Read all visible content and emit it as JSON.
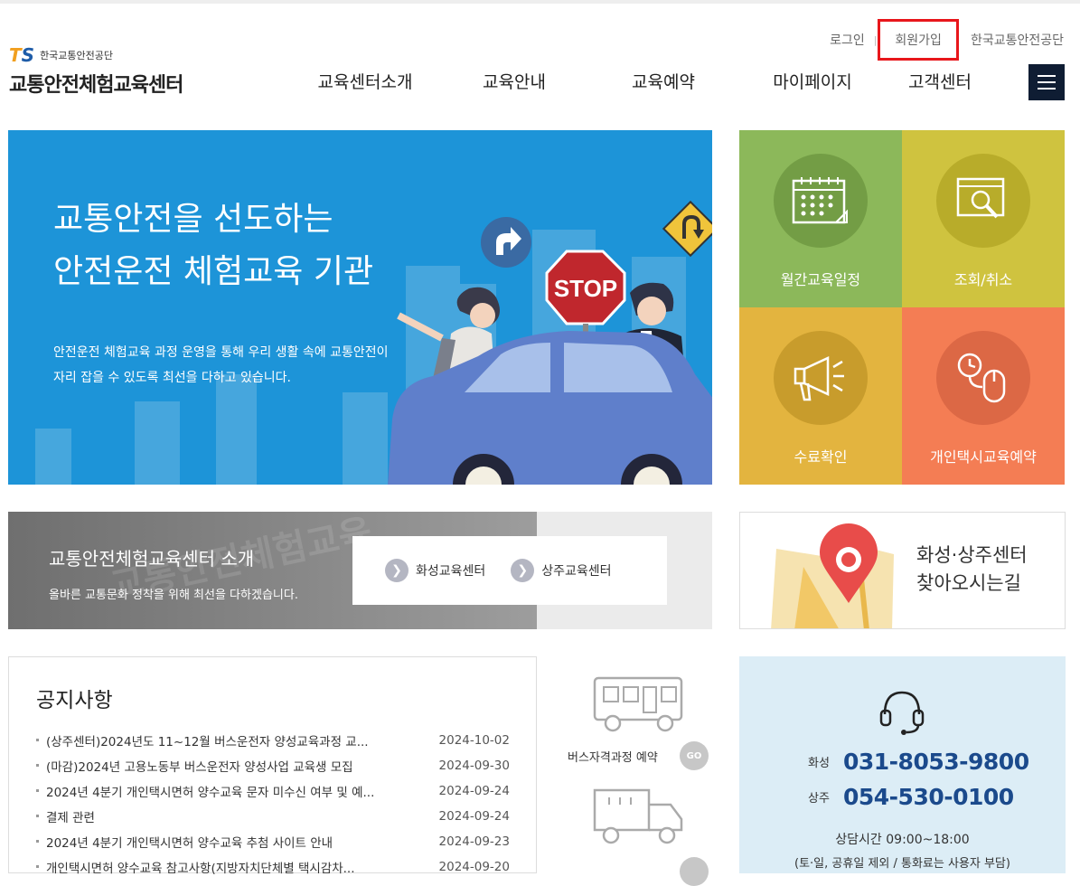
{
  "header": {
    "login": "로그인",
    "separator": "|",
    "join": "회원가입",
    "org_link": "한국교통안전공단",
    "logo_mark_t": "T",
    "logo_mark_s": "S",
    "logo_org": "한국교통안전공단",
    "logo_name": "교통안전체험교육센터"
  },
  "nav": {
    "items": [
      "교육센터소개",
      "교육안내",
      "교육예약",
      "마이페이지",
      "고객센터"
    ]
  },
  "hero": {
    "title_line1": "교통안전을 선도하는",
    "title_line2": "안전운전 체험교육 기관",
    "desc_line1": "안전운전 체험교육 과정 운영을 통해 우리 생활 속에 교통안전이",
    "desc_line2": "자리 잡을 수 있도록 최선을 다하고 있습니다.",
    "stop_sign": "STOP"
  },
  "quick": {
    "items": [
      {
        "label": "월간교육일정",
        "color": "#8cb85a",
        "circle": "#739d45",
        "icon": "calendar-icon"
      },
      {
        "label": "조회/취소",
        "color": "#cfc33f",
        "circle": "#b8ac2a",
        "icon": "search-window-icon"
      },
      {
        "label": "수료확인",
        "color": "#e3b43f",
        "circle": "#c89c2c",
        "icon": "megaphone-icon"
      },
      {
        "label": "개인택시교육예약",
        "color": "#f47d54",
        "circle": "#dc6845",
        "icon": "mouse-clock-icon"
      }
    ]
  },
  "intro": {
    "bg_text": "교통안전체험교육",
    "title": "교통안전체험교육센터 소개",
    "subtitle": "올바른 교통문화 정착을 위해 최선을 다하겠습니다.",
    "link1": "화성교육센터",
    "link2": "상주교육센터"
  },
  "directions": {
    "line1": "화성·상주센터",
    "line2": "찾아오시는길"
  },
  "notice": {
    "title": "공지사항",
    "rows": [
      {
        "title": "(상주센터)2024년도 11~12월 버스운전자 양성교육과정 교...",
        "date": "2024-10-02"
      },
      {
        "title": "(마감)2024년 고용노동부 버스운전자 양성사업 교육생 모집",
        "date": "2024-09-30"
      },
      {
        "title": "2024년 4분기 개인택시면허 양수교육 문자 미수신 여부 및 예...",
        "date": "2024-09-24"
      },
      {
        "title": "결제 관련",
        "date": "2024-09-24"
      },
      {
        "title": "2024년 4분기 개인택시면허 양수교육 추첨 사이트 안내",
        "date": "2024-09-23"
      },
      {
        "title": "개인택시면허 양수교육 참고사항(지방자치단체별 택시감차...",
        "date": "2024-09-20"
      }
    ]
  },
  "bus": {
    "label": "버스자격과정 예약",
    "go": "GO"
  },
  "contact": {
    "city1": "화성",
    "tel1": "031-8053-9800",
    "city2": "상주",
    "tel2": "054-530-0100",
    "hours": "상담시간 09:00~18:00",
    "hours_note": "(토·일, 공휴일 제외 / 통화료는 사용자 부담)"
  }
}
